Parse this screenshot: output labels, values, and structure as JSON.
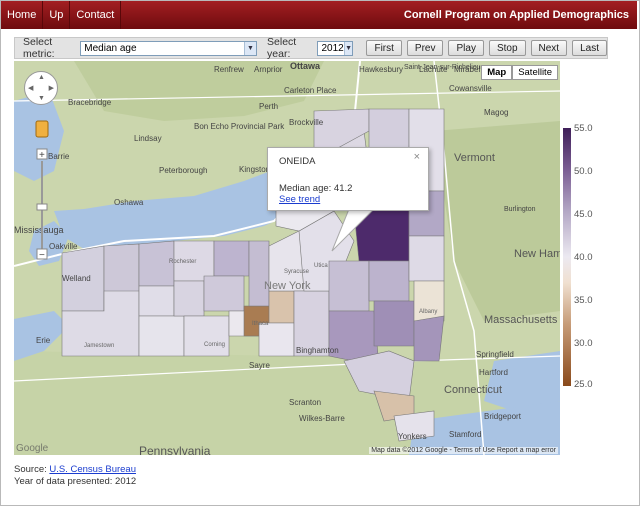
{
  "nav": {
    "items": [
      "Home",
      "Up",
      "Contact"
    ],
    "brand": "Cornell Program on Applied Demographics"
  },
  "controls": {
    "metric_label": "Select metric:",
    "metric_value": "Median age",
    "year_label": "Select year:",
    "year_value": "2012",
    "buttons": [
      "First",
      "Prev",
      "Play",
      "Stop",
      "Next",
      "Last"
    ]
  },
  "map": {
    "type_buttons": [
      "Map",
      "Satellite"
    ],
    "active_type": "Map",
    "attribution": "Map data ©2012 Google - Terms of Use   Report a map error",
    "logo": "Google",
    "place_labels": [
      "Ottawa",
      "Renfrew",
      "Arnprior",
      "Hawkesbury",
      "Lachute",
      "Mirabel",
      "Bracebridge",
      "Carleton Place",
      "Saint-Jean-sur-Richelieu",
      "Brockville",
      "Cowansville",
      "Lindsay",
      "Bon Echo Provincial Park",
      "Perth",
      "Magog",
      "Barrie",
      "Peterborough",
      "Kingston",
      "Oshawa",
      "Vermont",
      "Mississauga",
      "Oakville",
      "Welland",
      "Erie",
      "Jamestown",
      "New York",
      "Syracuse",
      "Ithaca",
      "Binghamton",
      "Albany",
      "New Hampshire",
      "Massachusetts",
      "Springfield",
      "Hartford",
      "Connecticut",
      "Bridgeport",
      "Stamford",
      "Scranton",
      "Wilkes-Barre",
      "Sayre",
      "Corning",
      "Pennsylvania",
      "Yonkers",
      "Utica",
      "Rochester",
      "Burlington"
    ],
    "accent": "#4d2a6b"
  },
  "popup": {
    "county": "ONEIDA",
    "metric_text": "Median age: 41.2",
    "link": "See trend",
    "close": "×"
  },
  "legend": {
    "ticks": [
      "55.0",
      "50.0",
      "45.0",
      "40.0",
      "35.0",
      "30.0",
      "25.0"
    ]
  },
  "footer": {
    "source_label": "Source:",
    "source_link": "U.S. Census Bureau",
    "year_text": "Year of data presented: 2012"
  }
}
